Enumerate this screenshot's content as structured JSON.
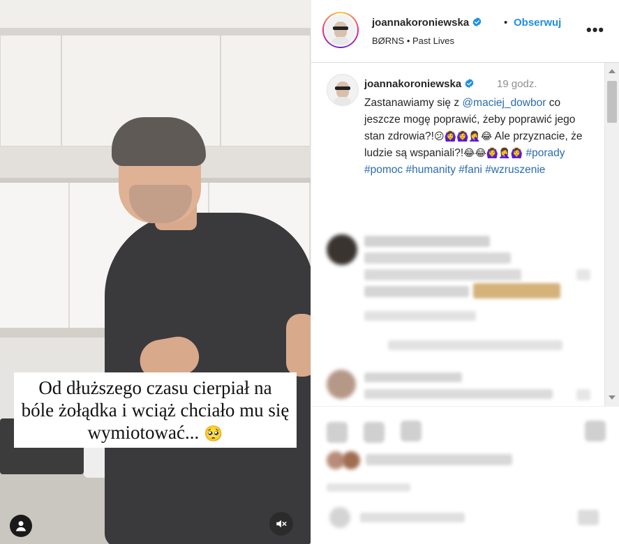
{
  "post": {
    "username": "joannakoroniewska",
    "follow_label": "Obserwuj",
    "separator": "•",
    "audio": "BØRNS • Past Lives",
    "more_label": "•••"
  },
  "caption": {
    "username": "joannakoroniewska",
    "time": "19 godz.",
    "text_1": "Zastanawiamy się z ",
    "mention": "@maciej_dowbor",
    "text_2": " co jeszcze mogę poprawić, żeby poprawić jego stan zdrowia?!",
    "emojis_1": "😕🙆‍♀️🙆‍♀️🤦‍♀️😂",
    "text_3": " Ale przyznacie, że ludzie są wspaniali?!",
    "emojis_2": "😂😂🙆‍♀️🤦‍♀️🙆‍♀️",
    "hashtags": [
      "#porady",
      "#pomoc",
      "#humanity",
      "#fani",
      "#wzruszenie"
    ]
  },
  "video": {
    "overlay_text": "Od dłuższego czasu cierpiał na bóle żołądka i wciąż chciało mu się wymiotować...",
    "overlay_emoji": "🥺"
  },
  "colors": {
    "link": "#2a6bb0",
    "follow": "#1e8fe0",
    "verified": "#1e8fe0"
  },
  "icons": [
    "verified-badge-icon",
    "more-options-icon",
    "mute-icon",
    "user-icon"
  ]
}
